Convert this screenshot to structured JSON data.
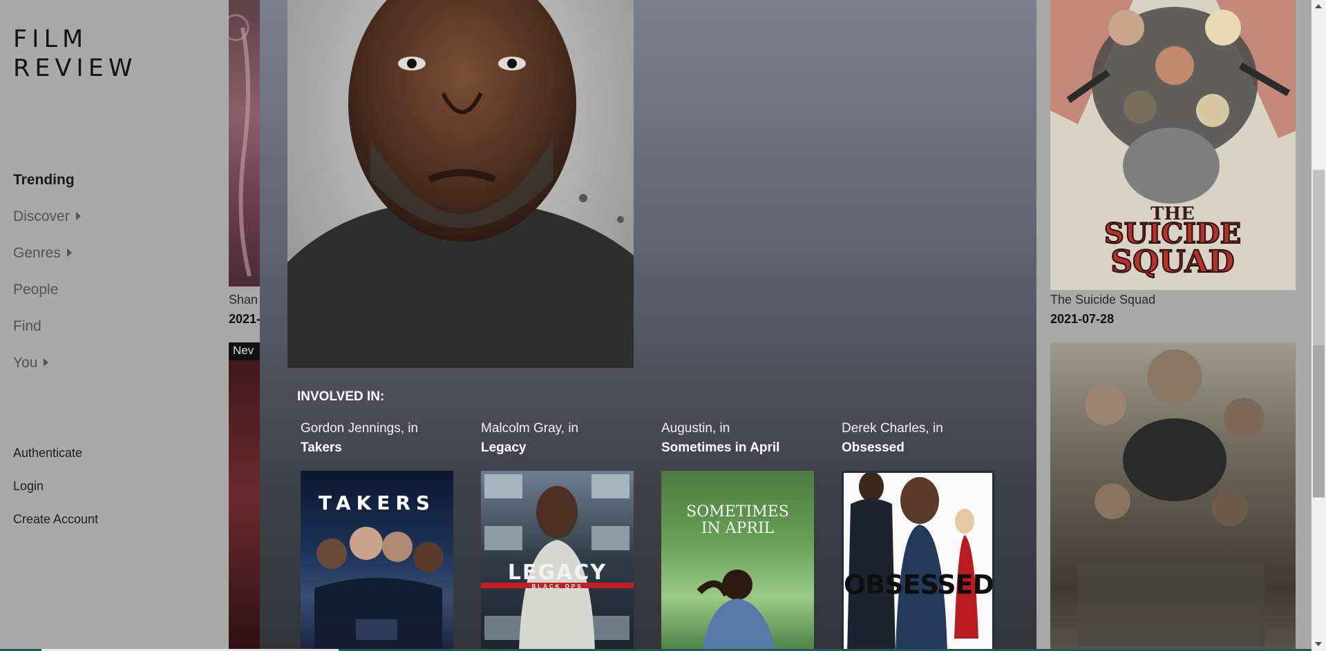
{
  "brand": {
    "line1": "FILM",
    "line2": "REVIEW"
  },
  "nav": [
    {
      "label": "Trending",
      "active": true
    },
    {
      "label": "Discover",
      "caret": true
    },
    {
      "label": "Genres",
      "caret": true
    },
    {
      "label": "People"
    },
    {
      "label": "Find"
    },
    {
      "label": "You",
      "caret": true
    }
  ],
  "auth": {
    "authenticate": "Authenticate",
    "login": "Login",
    "create_account": "Create Account"
  },
  "background_grid": {
    "left_card": {
      "title": "Shan",
      "date": "2021-",
      "badge": "Nev"
    },
    "right_card": {
      "title": "The Suicide Squad",
      "date": "2021-07-28"
    }
  },
  "person_modal": {
    "involved_heading": "INVOLVED IN:",
    "credits": [
      {
        "role": "Gordon Jennings, in",
        "film": "Takers",
        "poster_text": "TAKERS"
      },
      {
        "role": "Malcolm Gray, in",
        "film": "Legacy",
        "poster_text": "LEGACY",
        "poster_subtext": "BLACK OPS"
      },
      {
        "role": "Augustin, in",
        "film": "Sometimes in April",
        "poster_text_1": "SOMETIMES",
        "poster_text_2": "IN APRIL"
      },
      {
        "role": "Derek Charles, in",
        "film": "Obsessed",
        "poster_text": "OBSESSED"
      }
    ]
  },
  "poster_art": {
    "suicide_squad_line1": "THE",
    "suicide_squad_line2": "SUICIDE",
    "suicide_squad_line3": "SQUAD"
  },
  "colors": {
    "sidebar_bg": "#a9a9a9",
    "modal_top": "#7d7e8f",
    "modal_bottom": "#33343a",
    "accent_teal": "#1b5e57"
  }
}
